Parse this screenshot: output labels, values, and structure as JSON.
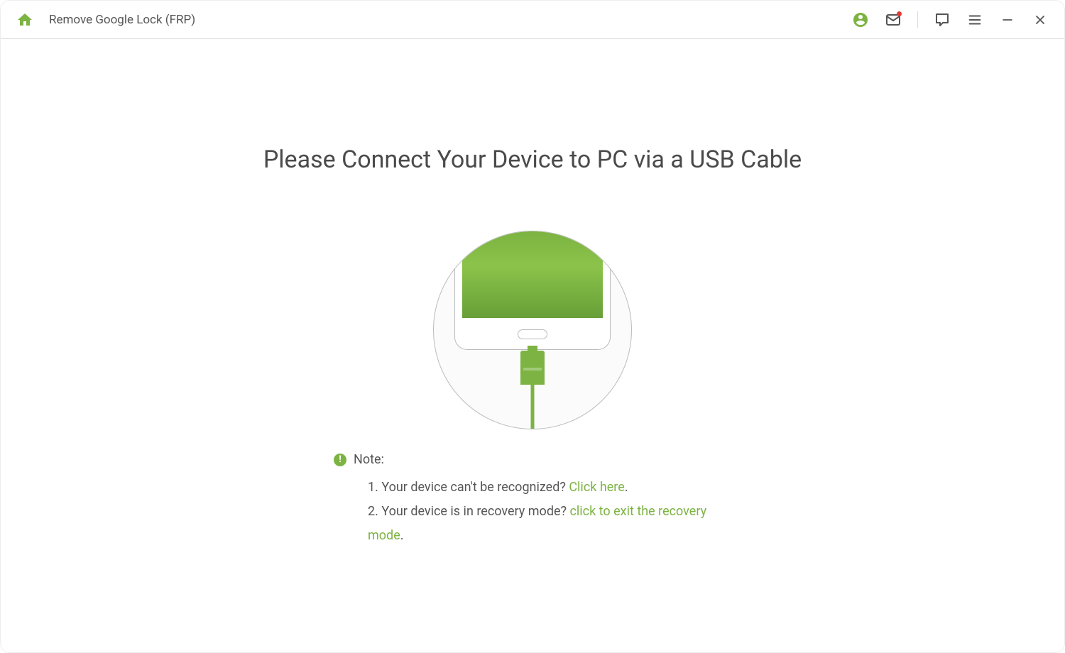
{
  "header": {
    "title": "Remove Google Lock (FRP)"
  },
  "main": {
    "heading": "Please Connect Your Device to PC via a USB Cable"
  },
  "note": {
    "label": "Note:",
    "items": [
      {
        "prefix": "1. ",
        "text": "Your device can't be recognized? ",
        "link": "Click here",
        "suffix": "."
      },
      {
        "prefix": "2. ",
        "text": "Your device is in recovery mode? ",
        "link": "click to exit the recovery mode",
        "suffix": "."
      }
    ]
  },
  "colors": {
    "accent": "#7cb342"
  }
}
